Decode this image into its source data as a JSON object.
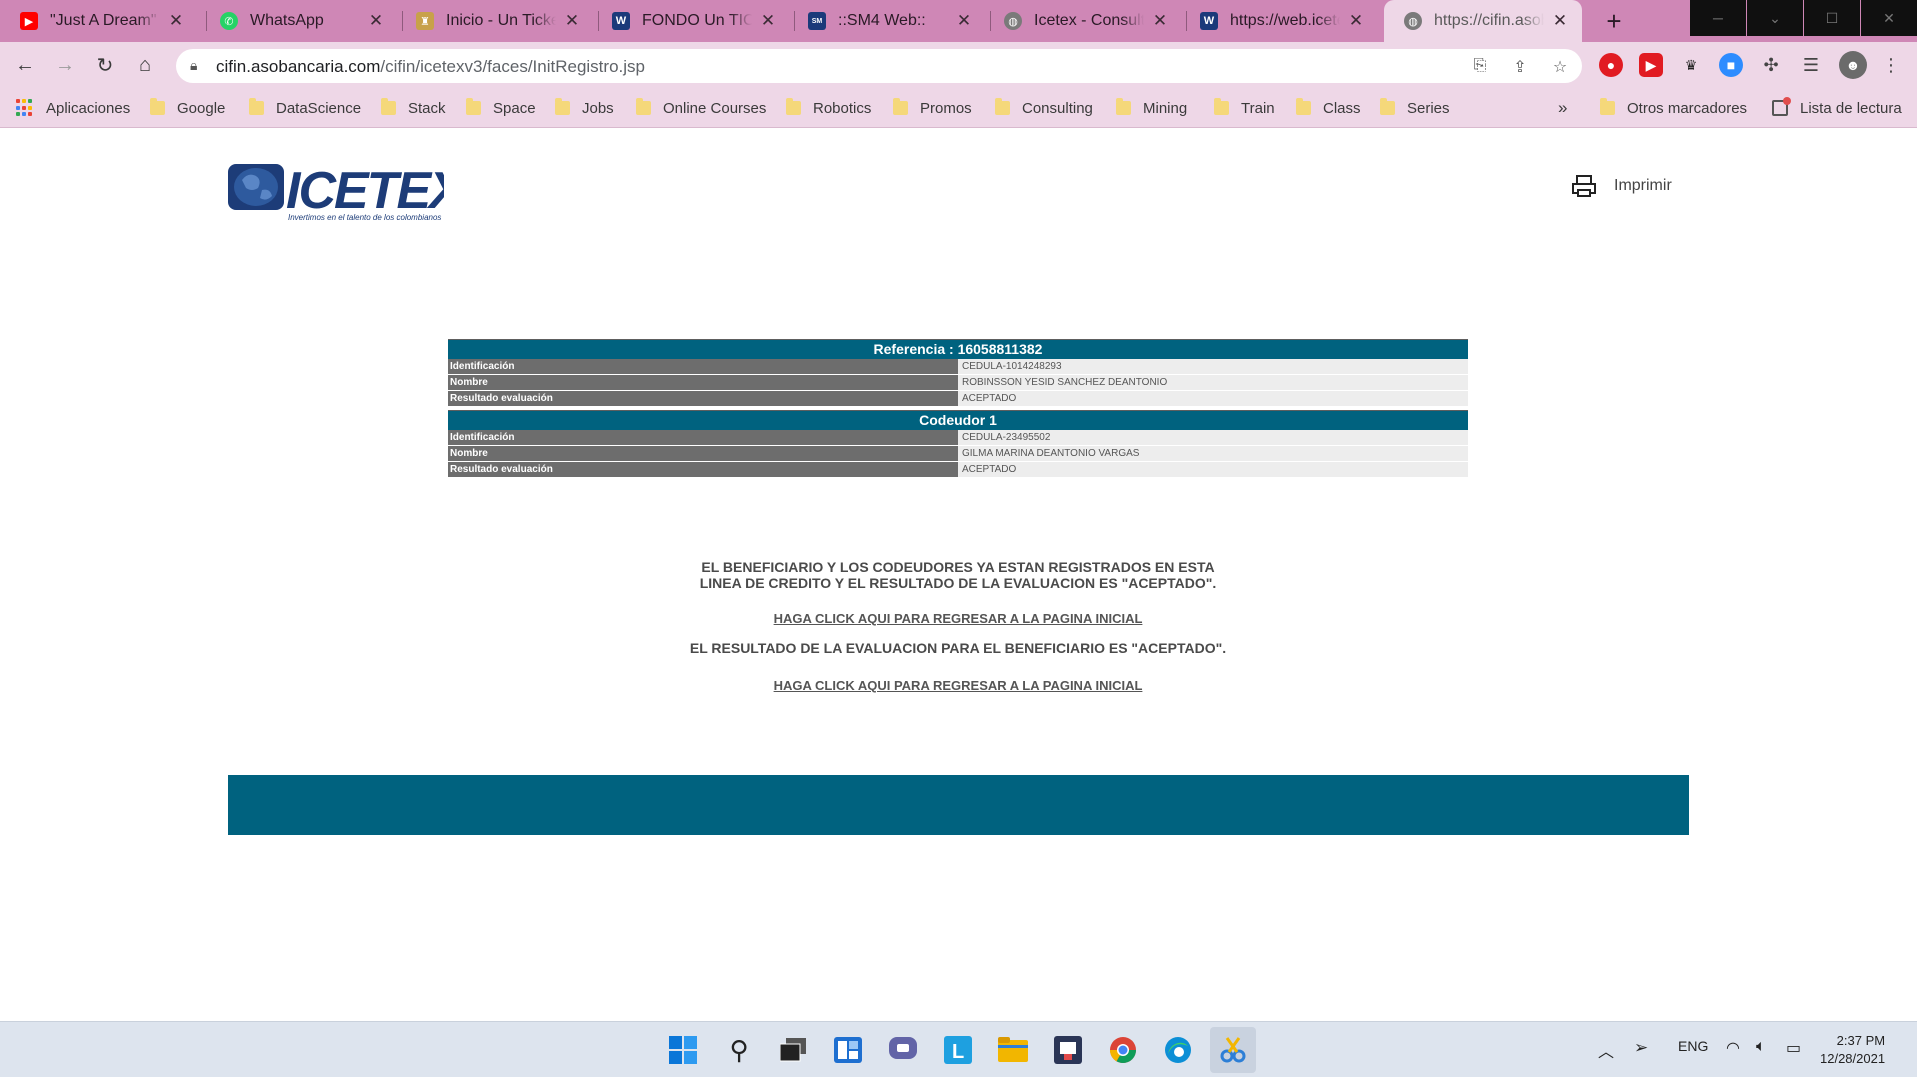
{
  "tabs": [
    {
      "title": "\"Just A Dream\" by",
      "icon": "youtube-icon",
      "color": "#ff0000"
    },
    {
      "title": "WhatsApp",
      "icon": "whatsapp-icon",
      "color": "#25d366"
    },
    {
      "title": "Inicio - Un Ticket",
      "icon": "coat-of-arms-icon",
      "color": "#c8a14a"
    },
    {
      "title": "FONDO Un TICket",
      "icon": "icetex-icon",
      "color": "#1b3a7a"
    },
    {
      "title": "::SM4 Web::",
      "icon": "sm4-icon",
      "color": "#1b3a7a"
    },
    {
      "title": "Icetex - Consulta",
      "icon": "globe-icon",
      "color": "#7a7a7a"
    },
    {
      "title": "https://web.icete",
      "icon": "icetex-icon",
      "color": "#1b3a7a"
    },
    {
      "title": "https://cifin.asob",
      "icon": "globe-icon",
      "color": "#7a7a7a",
      "active": true
    }
  ],
  "address": {
    "domain": "cifin.asobancaria.com",
    "path": "/cifin/icetexv3/faces/InitRegistro.jsp"
  },
  "bookmarks": {
    "apps": "Aplicaciones",
    "folders": [
      "Google",
      "DataScience",
      "Stack",
      "Space",
      "Jobs",
      "Online Courses",
      "Robotics",
      "Promos",
      "Consulting",
      "Mining",
      "Train",
      "Class",
      "Series"
    ],
    "more": "»",
    "other": "Otros marcadores",
    "reading_list": "Lista de lectura"
  },
  "page": {
    "logo_alt": "ICETEX",
    "print_label": "Imprimir",
    "referencia_header": "Referencia : 16058811382",
    "beneficiario": [
      {
        "label": "Identificación",
        "value": "CEDULA-1014248293"
      },
      {
        "label": "Nombre",
        "value": "ROBINSSON YESID SANCHEZ DEANTONIO"
      },
      {
        "label": "Resultado evaluación",
        "value": "ACEPTADO"
      }
    ],
    "codeudor_header": "Codeudor 1",
    "codeudor": [
      {
        "label": "Identificación",
        "value": "CEDULA-23495502"
      },
      {
        "label": "Nombre",
        "value": "GILMA MARINA DEANTONIO VARGAS"
      },
      {
        "label": "Resultado evaluación",
        "value": "ACEPTADO"
      }
    ],
    "message1_line1": "EL BENEFICIARIO Y LOS CODEUDORES YA ESTAN REGISTRADOS EN ESTA",
    "message1_line2": "LINEA DE CREDITO Y EL RESULTADO DE LA EVALUACION ES \"ACEPTADO\".",
    "link1": "HAGA CLICK AQUI PARA REGRESAR A LA PAGINA INICIAL",
    "message2": "EL RESULTADO DE LA EVALUACION PARA EL BENEFICIARIO ES \"ACEPTADO\".",
    "link2": "HAGA CLICK AQUI PARA REGRESAR A LA PAGINA INICIAL"
  },
  "taskbar": {
    "lang": "ENG",
    "time": "2:37 PM",
    "date": "12/28/2021"
  },
  "colors": {
    "brand": "#00627f",
    "label_bg": "#6d6d6d",
    "value_bg": "#ededed",
    "tab_strip": "#cf87b6",
    "toolbar": "#eed7e7"
  }
}
